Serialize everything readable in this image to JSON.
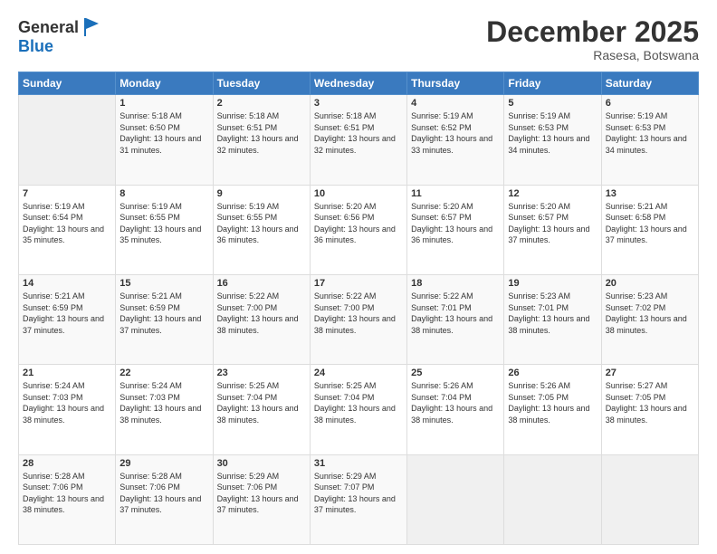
{
  "header": {
    "logo_general": "General",
    "logo_blue": "Blue",
    "month_title": "December 2025",
    "location": "Rasesa, Botswana"
  },
  "days_of_week": [
    "Sunday",
    "Monday",
    "Tuesday",
    "Wednesday",
    "Thursday",
    "Friday",
    "Saturday"
  ],
  "weeks": [
    [
      {
        "day": "",
        "sunrise": "",
        "sunset": "",
        "daylight": ""
      },
      {
        "day": "1",
        "sunrise": "5:18 AM",
        "sunset": "6:50 PM",
        "daylight": "13 hours and 31 minutes."
      },
      {
        "day": "2",
        "sunrise": "5:18 AM",
        "sunset": "6:51 PM",
        "daylight": "13 hours and 32 minutes."
      },
      {
        "day": "3",
        "sunrise": "5:18 AM",
        "sunset": "6:51 PM",
        "daylight": "13 hours and 32 minutes."
      },
      {
        "day": "4",
        "sunrise": "5:19 AM",
        "sunset": "6:52 PM",
        "daylight": "13 hours and 33 minutes."
      },
      {
        "day": "5",
        "sunrise": "5:19 AM",
        "sunset": "6:53 PM",
        "daylight": "13 hours and 34 minutes."
      },
      {
        "day": "6",
        "sunrise": "5:19 AM",
        "sunset": "6:53 PM",
        "daylight": "13 hours and 34 minutes."
      }
    ],
    [
      {
        "day": "7",
        "sunrise": "5:19 AM",
        "sunset": "6:54 PM",
        "daylight": "13 hours and 35 minutes."
      },
      {
        "day": "8",
        "sunrise": "5:19 AM",
        "sunset": "6:55 PM",
        "daylight": "13 hours and 35 minutes."
      },
      {
        "day": "9",
        "sunrise": "5:19 AM",
        "sunset": "6:55 PM",
        "daylight": "13 hours and 36 minutes."
      },
      {
        "day": "10",
        "sunrise": "5:20 AM",
        "sunset": "6:56 PM",
        "daylight": "13 hours and 36 minutes."
      },
      {
        "day": "11",
        "sunrise": "5:20 AM",
        "sunset": "6:57 PM",
        "daylight": "13 hours and 36 minutes."
      },
      {
        "day": "12",
        "sunrise": "5:20 AM",
        "sunset": "6:57 PM",
        "daylight": "13 hours and 37 minutes."
      },
      {
        "day": "13",
        "sunrise": "5:21 AM",
        "sunset": "6:58 PM",
        "daylight": "13 hours and 37 minutes."
      }
    ],
    [
      {
        "day": "14",
        "sunrise": "5:21 AM",
        "sunset": "6:59 PM",
        "daylight": "13 hours and 37 minutes."
      },
      {
        "day": "15",
        "sunrise": "5:21 AM",
        "sunset": "6:59 PM",
        "daylight": "13 hours and 37 minutes."
      },
      {
        "day": "16",
        "sunrise": "5:22 AM",
        "sunset": "7:00 PM",
        "daylight": "13 hours and 38 minutes."
      },
      {
        "day": "17",
        "sunrise": "5:22 AM",
        "sunset": "7:00 PM",
        "daylight": "13 hours and 38 minutes."
      },
      {
        "day": "18",
        "sunrise": "5:22 AM",
        "sunset": "7:01 PM",
        "daylight": "13 hours and 38 minutes."
      },
      {
        "day": "19",
        "sunrise": "5:23 AM",
        "sunset": "7:01 PM",
        "daylight": "13 hours and 38 minutes."
      },
      {
        "day": "20",
        "sunrise": "5:23 AM",
        "sunset": "7:02 PM",
        "daylight": "13 hours and 38 minutes."
      }
    ],
    [
      {
        "day": "21",
        "sunrise": "5:24 AM",
        "sunset": "7:03 PM",
        "daylight": "13 hours and 38 minutes."
      },
      {
        "day": "22",
        "sunrise": "5:24 AM",
        "sunset": "7:03 PM",
        "daylight": "13 hours and 38 minutes."
      },
      {
        "day": "23",
        "sunrise": "5:25 AM",
        "sunset": "7:04 PM",
        "daylight": "13 hours and 38 minutes."
      },
      {
        "day": "24",
        "sunrise": "5:25 AM",
        "sunset": "7:04 PM",
        "daylight": "13 hours and 38 minutes."
      },
      {
        "day": "25",
        "sunrise": "5:26 AM",
        "sunset": "7:04 PM",
        "daylight": "13 hours and 38 minutes."
      },
      {
        "day": "26",
        "sunrise": "5:26 AM",
        "sunset": "7:05 PM",
        "daylight": "13 hours and 38 minutes."
      },
      {
        "day": "27",
        "sunrise": "5:27 AM",
        "sunset": "7:05 PM",
        "daylight": "13 hours and 38 minutes."
      }
    ],
    [
      {
        "day": "28",
        "sunrise": "5:28 AM",
        "sunset": "7:06 PM",
        "daylight": "13 hours and 38 minutes."
      },
      {
        "day": "29",
        "sunrise": "5:28 AM",
        "sunset": "7:06 PM",
        "daylight": "13 hours and 37 minutes."
      },
      {
        "day": "30",
        "sunrise": "5:29 AM",
        "sunset": "7:06 PM",
        "daylight": "13 hours and 37 minutes."
      },
      {
        "day": "31",
        "sunrise": "5:29 AM",
        "sunset": "7:07 PM",
        "daylight": "13 hours and 37 minutes."
      },
      {
        "day": "",
        "sunrise": "",
        "sunset": "",
        "daylight": ""
      },
      {
        "day": "",
        "sunrise": "",
        "sunset": "",
        "daylight": ""
      },
      {
        "day": "",
        "sunrise": "",
        "sunset": "",
        "daylight": ""
      }
    ]
  ]
}
